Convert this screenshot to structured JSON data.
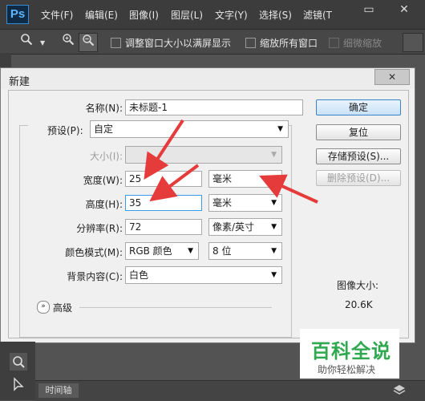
{
  "app": {
    "logo": "Ps"
  },
  "menu": {
    "items": [
      "文件(F)",
      "编辑(E)",
      "图像(I)",
      "图层(L)",
      "文字(Y)",
      "选择(S)",
      "滤镜(T"
    ]
  },
  "window_controls": {
    "minimize": "▭",
    "close": "✕"
  },
  "options_bar": {
    "resize_windows": "调整窗口大小以满屏显示",
    "zoom_all": "缩放所有窗口",
    "scrubby_zoom": "细微缩放"
  },
  "dialog": {
    "title": "新建",
    "close": "✕",
    "name_label": "名称(N):",
    "name_value": "未标题-1",
    "preset_label": "预设(P):",
    "preset_value": "自定",
    "size_label": "大小(I):",
    "size_value": "",
    "width_label": "宽度(W):",
    "width_value": "25",
    "width_unit": "毫米",
    "height_label": "高度(H):",
    "height_value": "35",
    "height_unit": "毫米",
    "resolution_label": "分辨率(R):",
    "resolution_value": "72",
    "resolution_unit": "像素/英寸",
    "color_mode_label": "颜色模式(M):",
    "color_mode_value": "RGB 颜色",
    "bit_depth_value": "8 位",
    "background_label": "背景内容(C):",
    "background_value": "白色",
    "advanced_label": "高级",
    "buttons": {
      "ok": "确定",
      "reset": "复位",
      "save_preset": "存储预设(S)...",
      "delete_preset": "删除预设(D)..."
    },
    "image_size_label": "图像大小:",
    "image_size_value": "20.6K"
  },
  "bottom": {
    "timeline_tab": "时间轴"
  },
  "watermark": {
    "main": "百科全说",
    "sub": "助你轻松解决"
  },
  "colors": {
    "annotation_arrow": "#e53b3b",
    "accent": "#3b83c8",
    "watermark_green": "#2fa84f"
  }
}
